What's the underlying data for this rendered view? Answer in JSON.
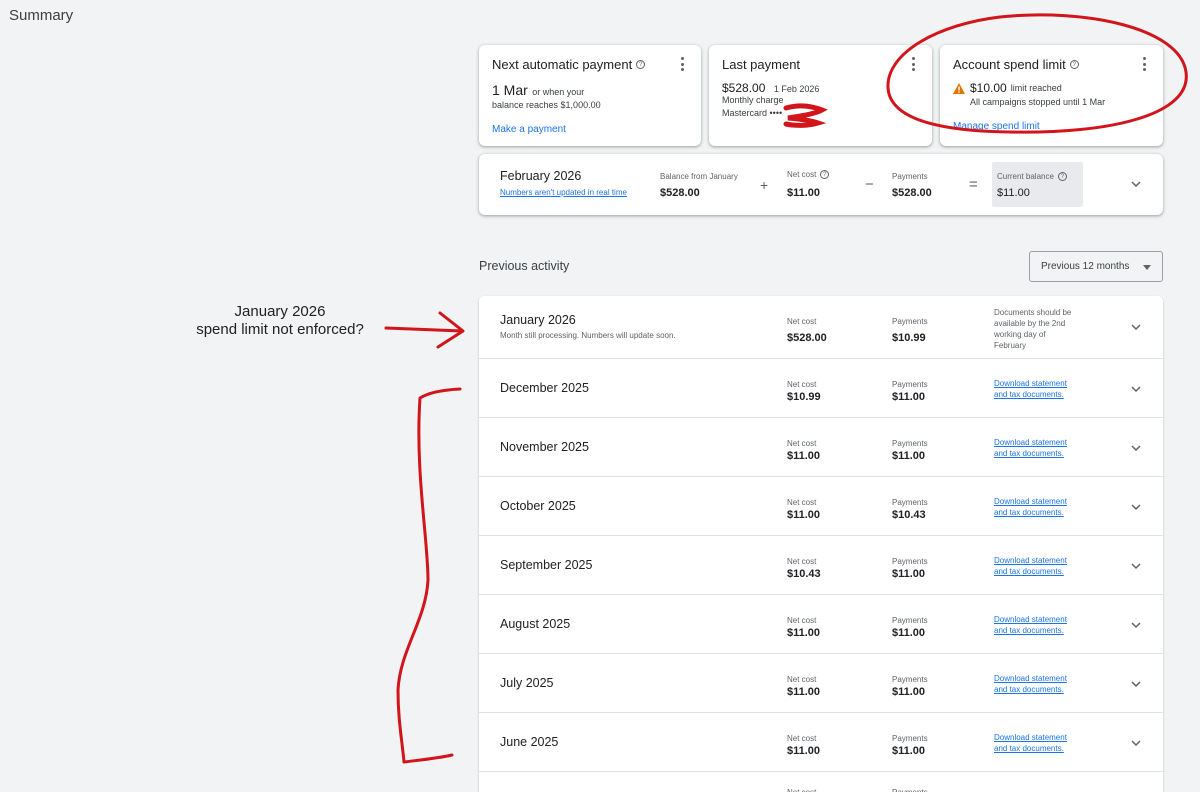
{
  "page": {
    "title": "Summary"
  },
  "cards": {
    "next_payment": {
      "title": "Next automatic payment",
      "date": "1 Mar",
      "line1": "or when your",
      "line2": "balance reaches $1,000.00",
      "action": "Make a payment"
    },
    "last_payment": {
      "title": "Last payment",
      "amount": "$528.00",
      "date": "1 Feb 2026",
      "charge": "Monthly charge",
      "card": "Mastercard ••••"
    },
    "spend_limit": {
      "title": "Account spend limit",
      "amount": "$10.00",
      "status": "limit reached",
      "note": "All campaigns stopped until 1 Mar",
      "action": "Manage spend limit"
    }
  },
  "current_period": {
    "month": "February 2026",
    "note": "Numbers aren't updated in real time",
    "balance_label": "Balance from January",
    "balance_value": "$528.00",
    "plus": "+",
    "net_cost_label": "Net cost",
    "net_cost_value": "$11.00",
    "minus": "−",
    "payments_label": "Payments",
    "payments_value": "$528.00",
    "equals": "=",
    "current_label": "Current balance",
    "current_value": "$11.00"
  },
  "previous": {
    "title": "Previous activity",
    "filter": "Previous 12 months",
    "net_cost_label": "Net cost",
    "payments_label": "Payments",
    "docs_line1": "Download statement",
    "docs_line2": "and tax documents.",
    "january": {
      "month": "January 2026",
      "sub": "Month still processing. Numbers will update soon.",
      "net_cost": "$528.00",
      "payments": "$10.99",
      "docs_note": [
        "Documents should be",
        "available by the 2nd",
        "working day of",
        "February"
      ]
    },
    "rows": [
      {
        "month": "December 2025",
        "net_cost": "$10.99",
        "payments": "$11.00"
      },
      {
        "month": "November 2025",
        "net_cost": "$11.00",
        "payments": "$11.00"
      },
      {
        "month": "October 2025",
        "net_cost": "$11.00",
        "payments": "$10.43"
      },
      {
        "month": "September 2025",
        "net_cost": "$10.43",
        "payments": "$11.00"
      },
      {
        "month": "August 2025",
        "net_cost": "$11.00",
        "payments": "$11.00"
      },
      {
        "month": "July 2025",
        "net_cost": "$11.00",
        "payments": "$11.00"
      },
      {
        "month": "June 2025",
        "net_cost": "$11.00",
        "payments": "$11.00"
      }
    ]
  },
  "annotation": {
    "line1": "January 2026",
    "line2": "spend limit not enforced?"
  },
  "colors": {
    "link": "#1a73e8",
    "warning": "#e37400",
    "markup": "#d2151b",
    "background": "#f1f3f4"
  }
}
